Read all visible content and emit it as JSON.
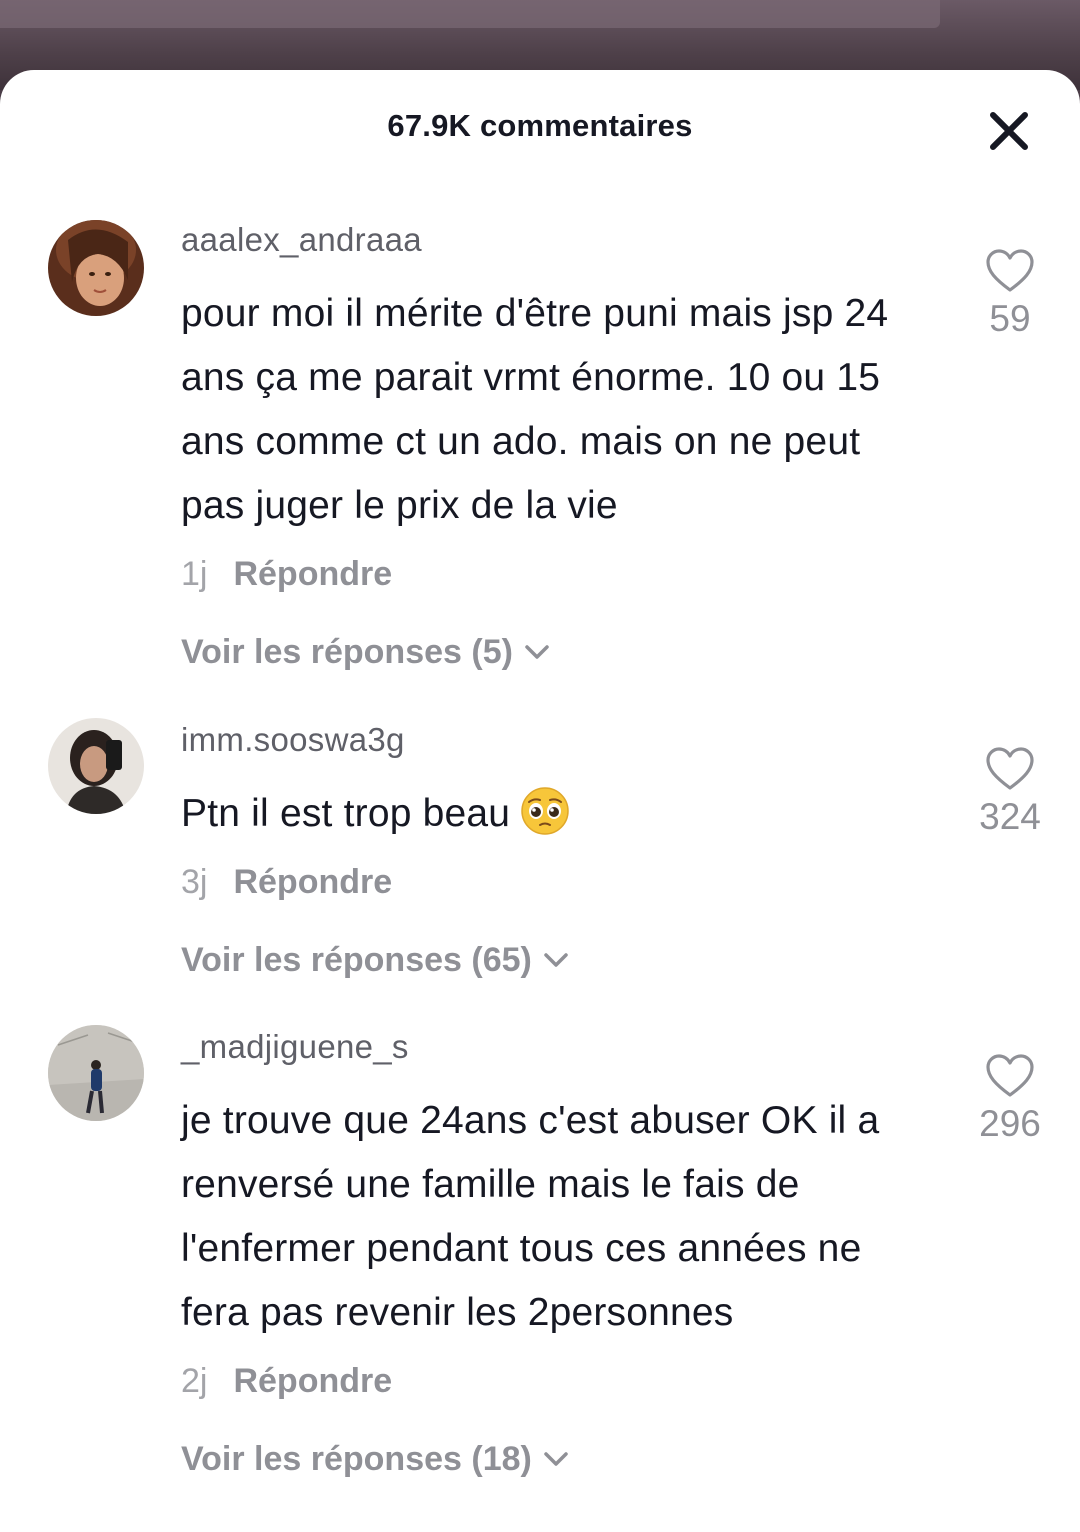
{
  "header": {
    "title": "67.9K commentaires",
    "close_icon": "close-icon"
  },
  "comments": [
    {
      "username": "aaalex_andraaa",
      "text": "pour moi il mérite d'être puni mais jsp 24 ans ça me parait vrmt énorme. 10 ou 15 ans comme ct un ado. mais on ne peut pas juger le prix de la vie",
      "time": "1j",
      "reply_label": "Répondre",
      "replies_label": "Voir les réponses (5)",
      "likes": "59",
      "avatar_color": "#6b3a24"
    },
    {
      "username": "imm.sooswa3g",
      "text": "Ptn il est trop beau",
      "emoji": "pleading-face-emoji",
      "time": "3j",
      "reply_label": "Répondre",
      "replies_label": "Voir les réponses (65)",
      "likes": "324",
      "avatar_color": "#3a2f2c"
    },
    {
      "username": "_madjiguene_s",
      "text": "je trouve que 24ans c'est abuser OK il a renversé une famille mais le fais de l'enfermer pendant tous ces années ne fera pas revenir les 2personnes",
      "time": "2j",
      "reply_label": "Répondre",
      "replies_label": "Voir les réponses (18)",
      "likes": "296",
      "avatar_color": "#c9c7c2"
    }
  ],
  "colors": {
    "primary_text": "#161823",
    "secondary_text": "#8f9096",
    "username_text": "#5f6068"
  }
}
